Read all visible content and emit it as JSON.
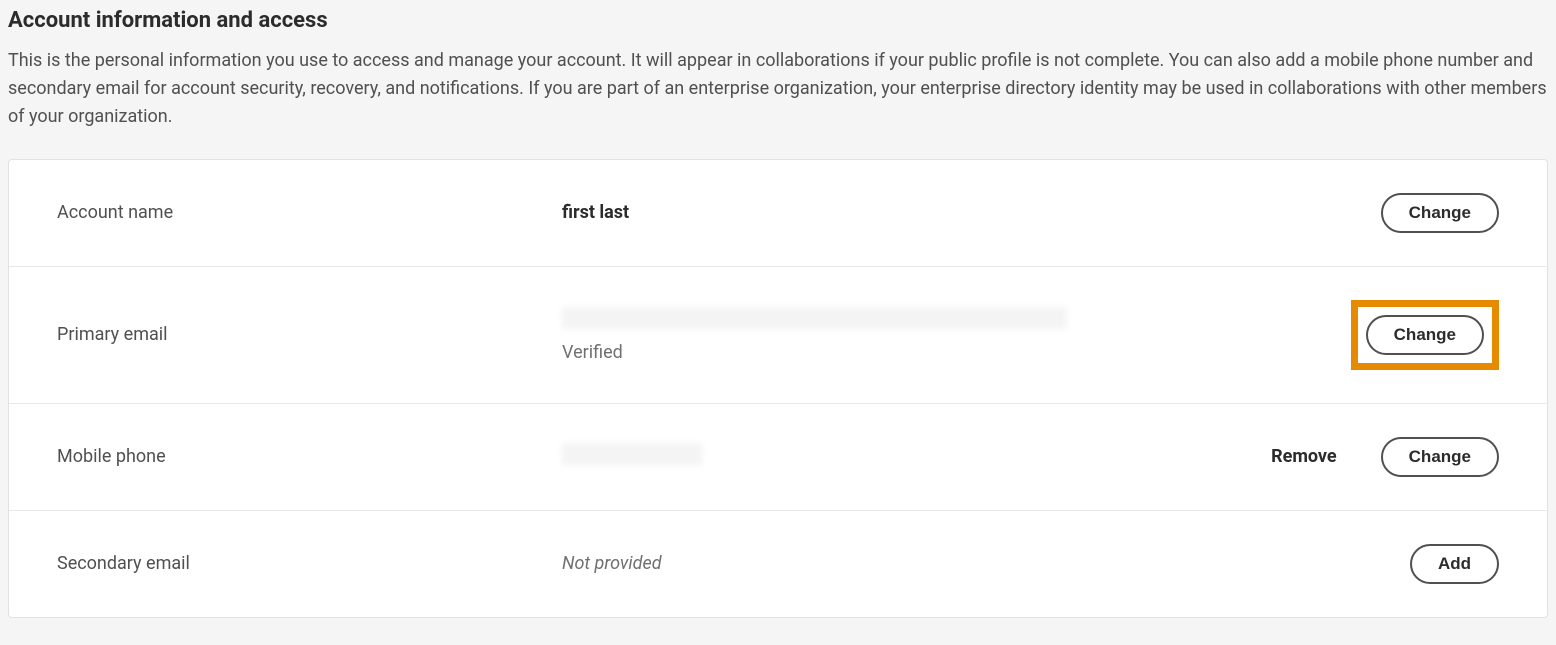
{
  "section": {
    "title": "Account information and access",
    "description": "This is the personal information you use to access and manage your account. It will appear in collaborations if your public profile is not complete. You can also add a mobile phone number and secondary email for account security, recovery, and notifications. If you are part of an enterprise organization, your enterprise directory identity may be used in collaborations with other members of your organization."
  },
  "rows": {
    "account_name": {
      "label": "Account name",
      "value": "first last",
      "action": "Change"
    },
    "primary_email": {
      "label": "Primary email",
      "value": "",
      "status": "Verified",
      "action": "Change"
    },
    "mobile_phone": {
      "label": "Mobile phone",
      "value": "",
      "remove_label": "Remove",
      "action": "Change"
    },
    "secondary_email": {
      "label": "Secondary email",
      "value": "Not provided",
      "action": "Add"
    }
  }
}
